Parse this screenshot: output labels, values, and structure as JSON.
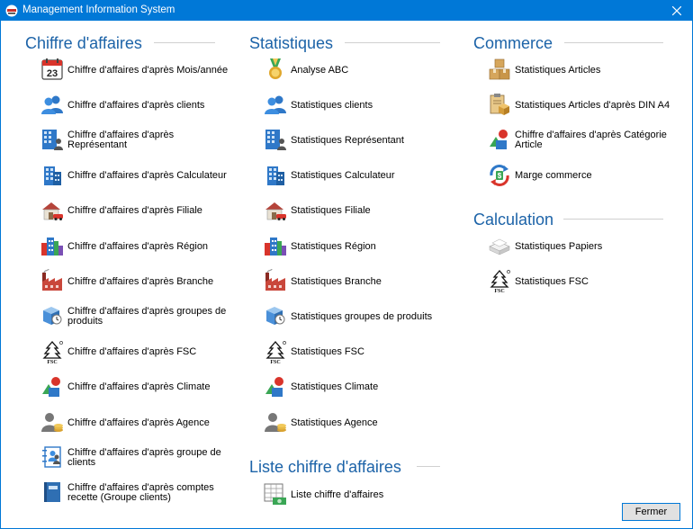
{
  "window": {
    "title": "Management Information System"
  },
  "sections": {
    "chiffre": {
      "title": "Chiffre d'affaires",
      "items": [
        {
          "label": "Chiffre d'affaires d'après Mois/année",
          "icon": "calendar-icon"
        },
        {
          "label": "Chiffre d'affaires d'après clients",
          "icon": "users-icon"
        },
        {
          "label": "Chiffre d'affaires d'après Représentant",
          "icon": "building-person-icon"
        },
        {
          "label": "Chiffre d'affaires d'après Calculateur",
          "icon": "building-icon"
        },
        {
          "label": "Chiffre d'affaires d'après Filiale",
          "icon": "house-car-icon"
        },
        {
          "label": "Chiffre d'affaires d'après Région",
          "icon": "city-icon"
        },
        {
          "label": "Chiffre d'affaires d'après Branche",
          "icon": "factory-icon"
        },
        {
          "label": "Chiffre d'affaires d'après groupes de produits",
          "icon": "product-boxes-icon"
        },
        {
          "label": "Chiffre d'affaires d'après FSC",
          "icon": "fsc-icon"
        },
        {
          "label": "Chiffre d'affaires d'après Climate",
          "icon": "shapes-icon"
        },
        {
          "label": "Chiffre d'affaires d'après Agence",
          "icon": "agent-coins-icon"
        },
        {
          "label": "Chiffre d'affaires d'après groupe de clients",
          "icon": "contact-book-icon"
        },
        {
          "label": "Chiffre d'affaires d'après comptes recette (Groupe clients)",
          "icon": "ledger-icon"
        }
      ]
    },
    "statistiques": {
      "title": "Statistiques",
      "items": [
        {
          "label": "Analyse ABC",
          "icon": "medal-icon"
        },
        {
          "label": "Statistiques clients",
          "icon": "users-icon"
        },
        {
          "label": "Statistiques Représentant",
          "icon": "building-person-icon"
        },
        {
          "label": "Statistiques Calculateur",
          "icon": "building-icon"
        },
        {
          "label": "Statistiques Filiale",
          "icon": "house-car-icon"
        },
        {
          "label": "Statistiques Région",
          "icon": "city-icon"
        },
        {
          "label": "Statistiques Branche",
          "icon": "factory-icon"
        },
        {
          "label": "Statistiques groupes de produits",
          "icon": "product-boxes-icon"
        },
        {
          "label": "Statistiques FSC",
          "icon": "fsc-icon"
        },
        {
          "label": "Statistiques Climate",
          "icon": "shapes-icon"
        },
        {
          "label": "Statistiques Agence",
          "icon": "agent-coins-icon"
        }
      ]
    },
    "liste": {
      "title": "Liste chiffre d'affaires",
      "items": [
        {
          "label": "Liste chiffre d'affaires",
          "icon": "table-money-icon"
        }
      ]
    },
    "commerce": {
      "title": "Commerce",
      "items": [
        {
          "label": "Statistiques Articles",
          "icon": "boxes-icon"
        },
        {
          "label": "Statistiques Articles d'après DIN A4",
          "icon": "clipboard-box-icon"
        },
        {
          "label": "Chiffre d'affaires d'après Catégorie Article",
          "icon": "shapes-icon"
        },
        {
          "label": "Marge commerce",
          "icon": "money-cycle-icon"
        }
      ]
    },
    "calculation": {
      "title": "Calculation",
      "items": [
        {
          "label": "Statistiques Papiers",
          "icon": "paper-stack-icon"
        },
        {
          "label": "Statistiques FSC",
          "icon": "fsc-icon"
        }
      ]
    }
  },
  "calendar_day": "23",
  "buttons": {
    "close": "Fermer"
  },
  "colors": {
    "titlebar": "#0078d7",
    "section_title": "#1c63a8",
    "accent_blue": "#2f78c8"
  }
}
